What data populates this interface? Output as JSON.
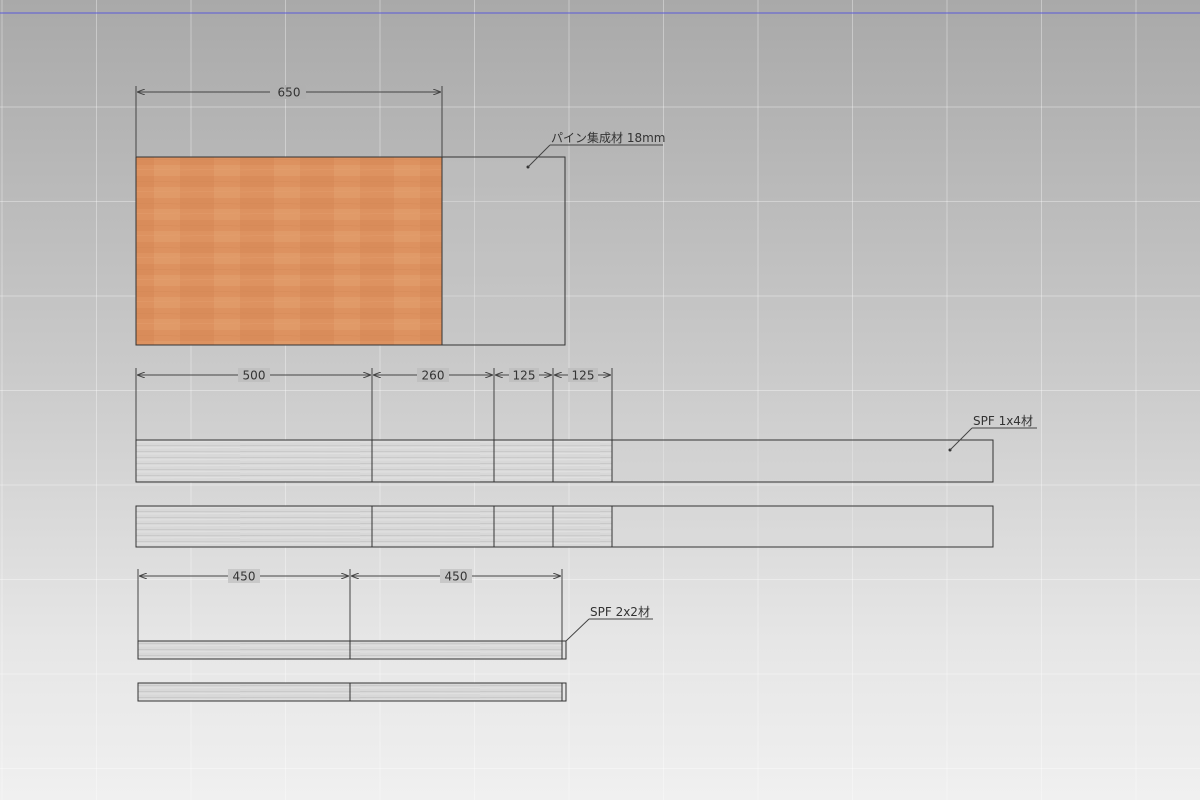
{
  "colors": {
    "background_top": "#a9a9a9",
    "background_bottom": "#f0f0f0",
    "outline": "#333333",
    "dimension_line": "#444444",
    "pine_wood": "#dd9260",
    "spf_wood": "#d6d6d6",
    "axis_blue": "#5a5ad8"
  },
  "icons": {
    "dimension_arrow": "dimension-arrow-icon",
    "leader_dot": "leader-dot-icon"
  },
  "panel": {
    "label": "パイン集成材 18mm",
    "dims": [
      "650"
    ]
  },
  "board_1x4": {
    "label": "SPF 1x4材",
    "dims": [
      "500",
      "260",
      "125",
      "125"
    ]
  },
  "board_2x2": {
    "label": "SPF 2x2材",
    "dims": [
      "450",
      "450"
    ]
  }
}
